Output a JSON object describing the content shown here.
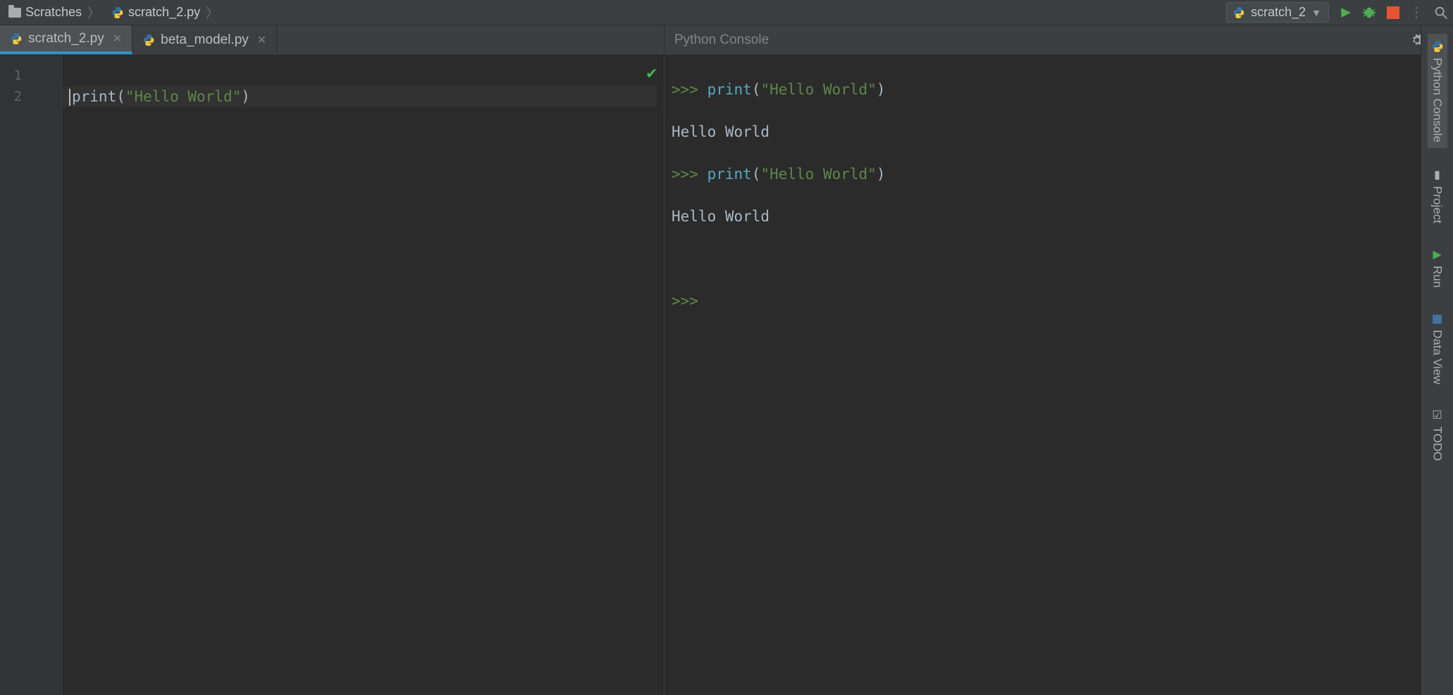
{
  "breadcrumb": {
    "root": "Scratches",
    "file": "scratch_2.py"
  },
  "runconfig": {
    "name": "scratch_2"
  },
  "tabs": [
    {
      "label": "scratch_2.py",
      "active": true
    },
    {
      "label": "beta_model.py",
      "active": false
    }
  ],
  "console_title": "Python Console",
  "editor": {
    "gutter": [
      "1",
      "2"
    ],
    "line1": {
      "fn": "print",
      "lp": "(",
      "str": "\"Hello World\"",
      "rp": ")"
    }
  },
  "console": {
    "p1": ">>>",
    "cmd": {
      "fn": "print",
      "lp": "(",
      "str": "\"Hello World\"",
      "rp": ")"
    },
    "out": "Hello World",
    "p_empty": ">>>"
  },
  "right_tools": {
    "python_console": "Python Console",
    "project": "Project",
    "run": "Run",
    "data_view": "Data View",
    "todo": "TODO"
  }
}
